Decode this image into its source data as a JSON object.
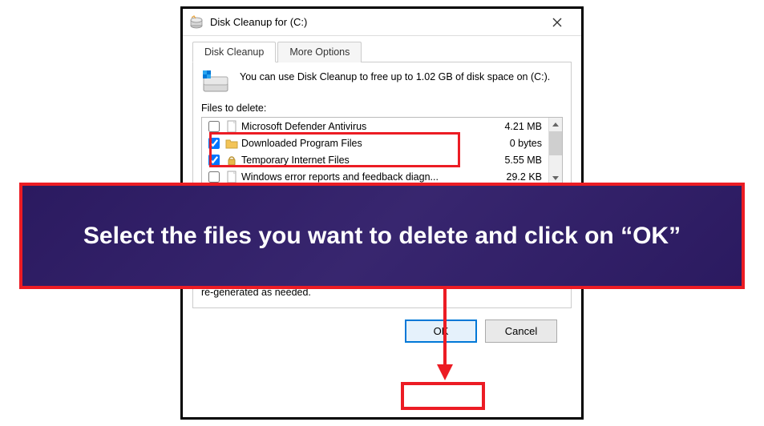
{
  "window": {
    "title": "Disk Cleanup for  (C:)"
  },
  "tabs": {
    "cleanup": "Disk Cleanup",
    "more": "More Options"
  },
  "info": {
    "text": "You can use Disk Cleanup to free up to 1.02 GB of disk space on (C:)."
  },
  "labels": {
    "files_to_delete": "Files to delete:",
    "description_tail": "re-generated as needed."
  },
  "files": [
    {
      "checked": false,
      "icon": "file-icon",
      "name": "Microsoft Defender Antivirus",
      "size": "4.21 MB"
    },
    {
      "checked": true,
      "icon": "folder-icon",
      "name": "Downloaded Program Files",
      "size": "0 bytes"
    },
    {
      "checked": true,
      "icon": "lock-icon",
      "name": "Temporary Internet Files",
      "size": "5.55 MB"
    },
    {
      "checked": false,
      "icon": "file-icon",
      "name": "Windows error reports and feedback diagn...",
      "size": "29.2 KB"
    }
  ],
  "buttons": {
    "ok": "OK",
    "cancel": "Cancel"
  },
  "annotation": {
    "text": "Select the files you want to delete and click on “OK”"
  }
}
